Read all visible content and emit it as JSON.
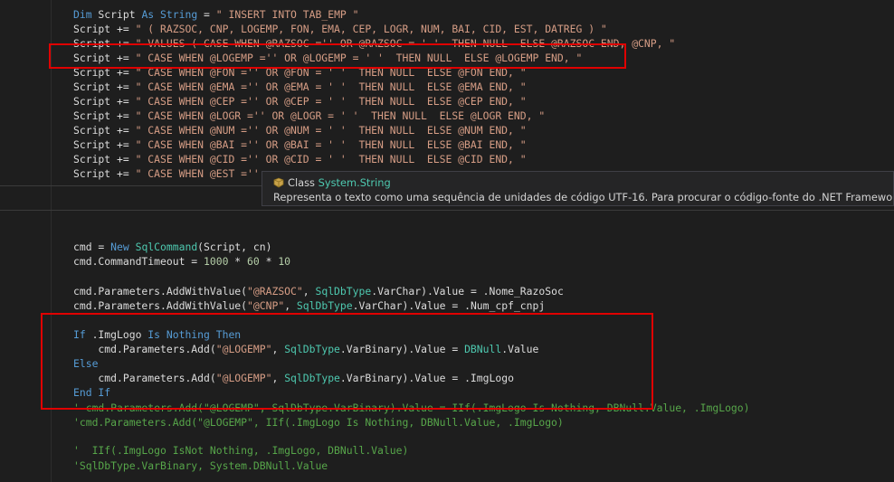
{
  "code": {
    "l1": [
      "Dim",
      " Script ",
      "As",
      " ",
      "String",
      " = ",
      "\" INSERT INTO TAB_EMP \""
    ],
    "l2": [
      "Script += ",
      "\" ( RAZSOC, CNP, LOGEMP, FON, EMA, CEP, LOGR, NUM, BAI, CID, EST, DATREG ) \""
    ],
    "l3": [
      "Script += ",
      "\" VALUES ( CASE WHEN @RAZSOC ='' OR @RAZSOC = ' '  THEN NULL  ELSE @RAZSOC END, @CNP, \""
    ],
    "l4": [
      "Script += ",
      "\" CASE WHEN @LOGEMP ='' OR @LOGEMP = ' '  THEN NULL  ELSE @LOGEMP END, \""
    ],
    "l5": [
      "Script += ",
      "\" CASE WHEN @FON ='' OR @FON = ' '  THEN NULL  ELSE @FON END, \""
    ],
    "l6": [
      "Script += ",
      "\" CASE WHEN @EMA ='' OR @EMA = ' '  THEN NULL  ELSE @EMA END, \""
    ],
    "l7": [
      "Script += ",
      "\" CASE WHEN @CEP ='' OR @CEP = ' '  THEN NULL  ELSE @CEP END, \""
    ],
    "l8": [
      "Script += ",
      "\" CASE WHEN @LOGR ='' OR @LOGR = ' '  THEN NULL  ELSE @LOGR END, \""
    ],
    "l9": [
      "Script += ",
      "\" CASE WHEN @NUM ='' OR @NUM = ' '  THEN NULL  ELSE @NUM END, \""
    ],
    "l10": [
      "Script += ",
      "\" CASE WHEN @BAI ='' OR @BAI = ' '  THEN NULL  ELSE @BAI END, \""
    ],
    "l11": [
      "Script += ",
      "\" CASE WHEN @CID ='' OR @CID = ' '  THEN NULL  ELSE @CID END, \""
    ],
    "l12": [
      "Script += ",
      "\" CASE WHEN @EST =''"
    ],
    "l13": [
      "cmd = ",
      "New",
      " ",
      "SqlCommand",
      "(Script, cn)"
    ],
    "l14": [
      "cmd.CommandTimeout = ",
      "1000",
      " * ",
      "60",
      " * ",
      "10"
    ],
    "l15": [
      "cmd.Parameters.AddWithValue(",
      "\"@RAZSOC\"",
      ", ",
      "SqlDbType",
      ".VarChar).Value = .Nome_RazoSoc"
    ],
    "l16": [
      "cmd.Parameters.AddWithValue(",
      "\"@CNP\"",
      ", ",
      "SqlDbType",
      ".VarChar).Value = .Num_cpf_cnpj"
    ],
    "l17": [
      "If",
      " .ImgLogo ",
      "Is Nothing",
      " ",
      "Then"
    ],
    "l18": [
      "    cmd.Parameters.Add(",
      "\"@LOGEMP\"",
      ", ",
      "SqlDbType",
      ".VarBinary).Value = ",
      "DBNull",
      ".Value"
    ],
    "l19": [
      "Else"
    ],
    "l20": [
      "    cmd.Parameters.Add(",
      "\"@LOGEMP\"",
      ", ",
      "SqlDbType",
      ".VarBinary).Value = .ImgLogo"
    ],
    "l21": [
      "End If"
    ],
    "l22": [
      "' cmd.Parameters.Add(\"@LOGEMP\", SqlDbType.VarBinary).Value = IIf(.ImgLogo Is Nothing, DBNull.Value, .ImgLogo)"
    ],
    "l23": [
      "'cmd.Parameters.Add(\"@LOGEMP\", IIf(.ImgLogo Is Nothing, DBNull.Value, .ImgLogo)"
    ],
    "l24": [
      "'  IIf(.ImgLogo IsNot Nothing, .ImgLogo, DBNull.Value)"
    ],
    "l25": [
      "'SqlDbType.VarBinary, System.DBNull.Value"
    ]
  },
  "tooltip": {
    "kind": "Class",
    "type": "System.String",
    "description": "Representa o texto como uma sequência de unidades de código UTF-16. Para procurar o código-fonte do .NET Framework para este"
  },
  "icons": {
    "tooltip": "class-icon"
  },
  "colors": {
    "background": "#1e1e1e",
    "keyword": "#569cd6",
    "string": "#d69d85",
    "type": "#4ec9b0",
    "comment": "#57a64a",
    "number": "#b5cea8",
    "highlight_box": "#e00000"
  }
}
